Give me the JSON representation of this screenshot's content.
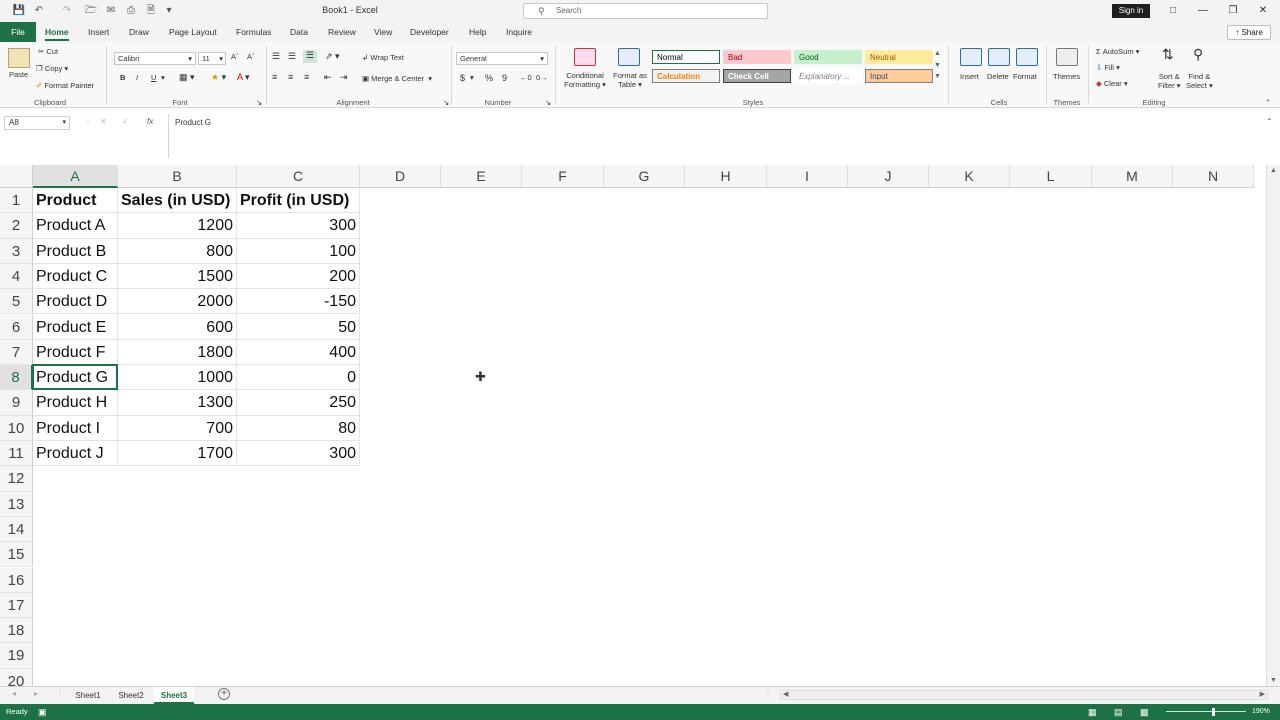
{
  "title_bar": {
    "doc_title": "Book1  -  Excel",
    "search_placeholder": "Search",
    "sign_in": "Sign in"
  },
  "tabs": [
    "File",
    "Home",
    "Insert",
    "Draw",
    "Page Layout",
    "Formulas",
    "Data",
    "Review",
    "View",
    "Developer",
    "Help",
    "Inquire"
  ],
  "share_label": "Share",
  "ribbon": {
    "clipboard": {
      "label": "Clipboard",
      "paste": "Paste",
      "cut": "Cut",
      "copy": "Copy",
      "format_painter": "Format Painter"
    },
    "font": {
      "label": "Font",
      "name": "Calibri",
      "size": "11",
      "bold": "B",
      "italic": "I",
      "underline": "U"
    },
    "alignment": {
      "label": "Alignment",
      "wrap_text": "Wrap Text",
      "merge_center": "Merge & Center"
    },
    "number": {
      "label": "Number",
      "format": "General",
      "currency": "$",
      "percent": "%",
      "comma": "9"
    },
    "styles": {
      "label": "Styles",
      "conditional_formatting": [
        "Conditional",
        "Formatting"
      ],
      "format_as_table": [
        "Format as",
        "Table"
      ],
      "cells": [
        {
          "name": "Normal",
          "bg": "#ffffff",
          "fg": "#000000",
          "border": "#1e7145"
        },
        {
          "name": "Bad",
          "bg": "#ffc7ce",
          "fg": "#9c0006",
          "border": "#ffc7ce"
        },
        {
          "name": "Good",
          "bg": "#c6efce",
          "fg": "#006100",
          "border": "#c6efce"
        },
        {
          "name": "Neutral",
          "bg": "#ffeb9c",
          "fg": "#9c5700",
          "border": "#ffeb9c"
        },
        {
          "name": "Calculation",
          "bg": "#f2f2f2",
          "fg": "#fa7d00",
          "border": "#7f7f7f"
        },
        {
          "name": "Check Cell",
          "bg": "#a5a5a5",
          "fg": "#ffffff",
          "border": "#3f3f3f"
        },
        {
          "name": "Explanatory ...",
          "bg": "#ffffff",
          "fg": "#7f7f7f",
          "border": "#ffffff"
        },
        {
          "name": "Input",
          "bg": "#ffcc99",
          "fg": "#3f3f76",
          "border": "#7f7f7f"
        }
      ]
    },
    "cells": {
      "label": "Cells",
      "insert": "Insert",
      "delete": "Delete",
      "format": "Format"
    },
    "themes": {
      "label": "Themes",
      "themes": "Themes"
    },
    "editing": {
      "label": "Editing",
      "autosum": "AutoSum",
      "fill": "Fill",
      "clear": "Clear",
      "sort_filter": [
        "Sort &",
        "Filter"
      ],
      "find_select": [
        "Find &",
        "Select"
      ]
    }
  },
  "formula_bar": {
    "name_box": "A8",
    "fx": "fx",
    "content": "Product G"
  },
  "columns": [
    "A",
    "B",
    "C",
    "D",
    "E",
    "F",
    "G",
    "H",
    "I",
    "J",
    "K",
    "L",
    "M",
    "N"
  ],
  "row_numbers": [
    "1",
    "2",
    "3",
    "4",
    "5",
    "6",
    "7",
    "8",
    "9",
    "10",
    "11",
    "12",
    "13",
    "14",
    "15",
    "16",
    "17",
    "18",
    "19",
    "20"
  ],
  "table": {
    "headers": [
      "Product",
      "Sales (in USD)",
      "Profit (in USD)"
    ],
    "rows": [
      [
        "Product A",
        "1200",
        "300"
      ],
      [
        "Product B",
        "800",
        "100"
      ],
      [
        "Product C",
        "1500",
        "200"
      ],
      [
        "Product D",
        "2000",
        "-150"
      ],
      [
        "Product E",
        "600",
        "50"
      ],
      [
        "Product F",
        "1800",
        "400"
      ],
      [
        "Product G",
        "1000",
        "0"
      ],
      [
        "Product H",
        "1300",
        "250"
      ],
      [
        "Product I",
        "700",
        "80"
      ],
      [
        "Product J",
        "1700",
        "300"
      ]
    ]
  },
  "sheets": [
    "Sheet1",
    "Sheet2",
    "Sheet3"
  ],
  "active_sheet": "Sheet3",
  "status": {
    "ready": "Ready",
    "zoom": "190%"
  }
}
